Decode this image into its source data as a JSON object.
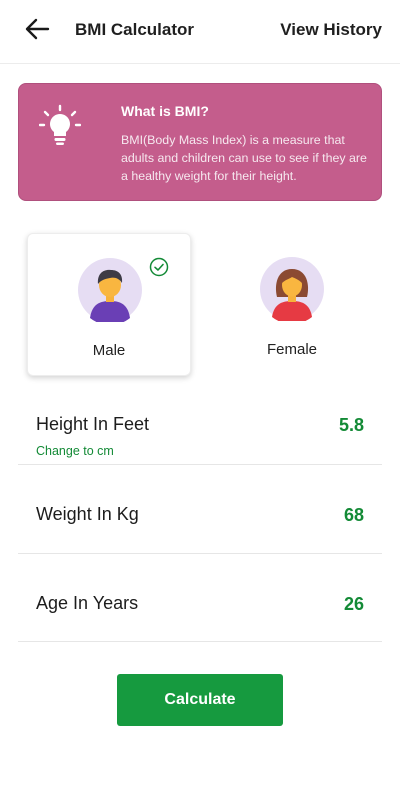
{
  "header": {
    "title": "BMI Calculator",
    "history_label": "View History",
    "back_icon": "back-arrow-icon"
  },
  "info_card": {
    "icon": "lightbulb-icon",
    "title": "What is BMI?",
    "description": "BMI(Body Mass Index) is a measure that adults and children can use to see if they are a healthy weight for their height.",
    "background_color": "#c45d8c"
  },
  "gender": {
    "options": [
      {
        "label": "Male",
        "selected": true,
        "icon": "male-avatar-icon"
      },
      {
        "label": "Female",
        "selected": false,
        "icon": "female-avatar-icon"
      }
    ],
    "selected_icon": "check-circle-icon"
  },
  "fields": {
    "height": {
      "label": "Height In Feet",
      "value": "5.8",
      "change_unit_label": "Change to cm"
    },
    "weight": {
      "label": "Weight In Kg",
      "value": "68"
    },
    "age": {
      "label": "Age In Years",
      "value": "26"
    }
  },
  "calculate_label": "Calculate",
  "colors": {
    "accent_green": "#138a36",
    "button_green": "#169a3f",
    "card_pink": "#c45d8c"
  }
}
